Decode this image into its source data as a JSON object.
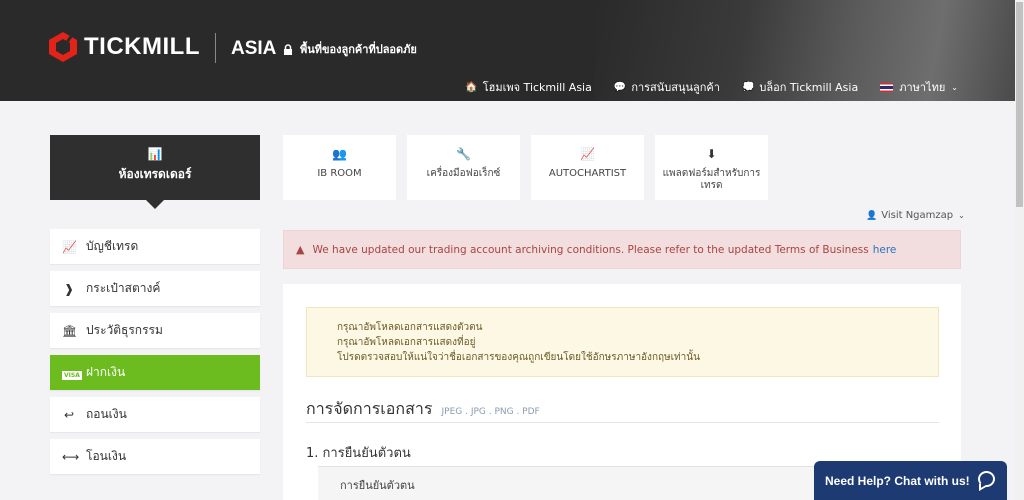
{
  "header": {
    "brand": "TICKMILL",
    "region": "ASIA",
    "secure_label": "พื้นที่ของลูกค้าที่ปลอดภัย",
    "nav": [
      {
        "icon": "home-icon",
        "glyph": "🏠",
        "label": "โฮมเพจ Tickmill Asia"
      },
      {
        "icon": "support-icon",
        "glyph": "💬",
        "label": "การสนับสนุนลูกค้า"
      },
      {
        "icon": "blog-icon",
        "glyph": "💭",
        "label": "บล็อก Tickmill Asia"
      }
    ],
    "language": "ภาษาไทย"
  },
  "sidebar": {
    "header_label": "ห้องเทรดเดอร์",
    "items": [
      {
        "label": "บัญชีเทรด",
        "icon": "chart-line-icon",
        "active": false
      },
      {
        "label": "กระเป๋าสตางค์",
        "icon": "wallet-icon",
        "active": false
      },
      {
        "label": "ประวัติธุรกรรม",
        "icon": "bank-icon",
        "active": false
      },
      {
        "label": "ฝากเงิน",
        "icon": "visa-card-icon",
        "active": true
      },
      {
        "label": "ถอนเงิน",
        "icon": "reply-arrow-icon",
        "active": false
      },
      {
        "label": "โอนเงิน",
        "icon": "transfer-arrows-icon",
        "active": false
      }
    ]
  },
  "tiles": [
    {
      "label": "IB ROOM",
      "icon": "users-icon"
    },
    {
      "label": "เครื่องมือฟอเร็กซ์",
      "icon": "wrench-icon"
    },
    {
      "label": "AUTOCHARTIST",
      "icon": "chart-icon"
    },
    {
      "label": "แพลตฟอร์มสำหรับการเทรด",
      "icon": "download-icon"
    }
  ],
  "user": {
    "name": "Visit Ngamzap"
  },
  "alert": {
    "text": "We have updated our trading account archiving conditions. Please refer to the updated Terms of Business",
    "link": "here"
  },
  "notice": {
    "lines": [
      "กรุณาอัพโหลดเอกสารแสดงตัวตน",
      "กรุณาอัพโหลดเอกสารแสดงที่อยู่",
      "โปรดตรวจสอบให้แน่ใจว่าชื่อเอกสารของคุณถูกเขียนโดยใช้อักษรภาษาอังกฤษเท่านั้น"
    ]
  },
  "documents": {
    "title": "การจัดการเอกสาร",
    "formats": "JPEG . JPG . PNG . PDF",
    "step": "1. การยืนยันตัวตน",
    "table_header": "การยืนยันตัวตน"
  },
  "chat": {
    "label": "Need Help? Chat with us!"
  },
  "colors": {
    "accent_green": "#6cbb1f",
    "dark": "#2f2f2f",
    "logo_red": "#e2231a",
    "chat_blue": "#1d3a73"
  }
}
